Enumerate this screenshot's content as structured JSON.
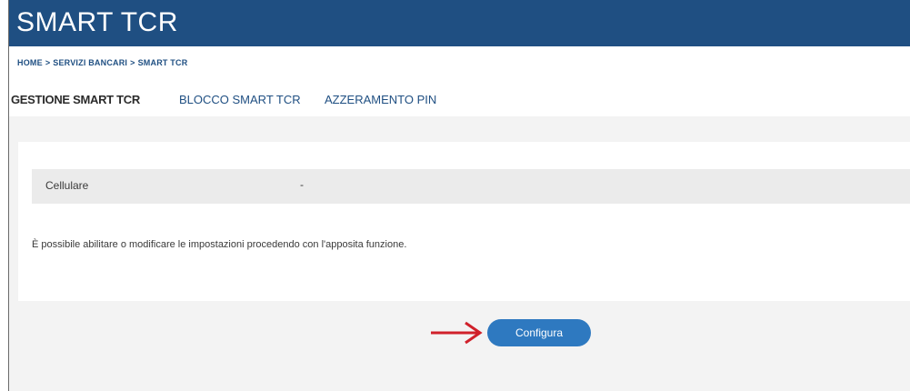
{
  "header": {
    "title": "SMART TCR"
  },
  "breadcrumb": {
    "items": [
      "HOME",
      "SERVIZI BANCARI",
      "SMART TCR"
    ],
    "separator": ">"
  },
  "tabs": [
    {
      "label": "GESTIONE SMART TCR",
      "active": true
    },
    {
      "label": "BLOCCO SMART TCR",
      "active": false
    },
    {
      "label": "AZZERAMENTO PIN",
      "active": false
    }
  ],
  "info": {
    "label": "Cellulare",
    "value": "-",
    "description": "È possibile abilitare o modificare le impostazioni procedendo con l'apposita funzione."
  },
  "actions": {
    "configure_label": "Configura"
  },
  "icons": {
    "pointer": "red-arrow-icon"
  },
  "colors": {
    "brand": "#1f4f82",
    "button": "#2e79c0",
    "arrow": "#d0202a"
  }
}
